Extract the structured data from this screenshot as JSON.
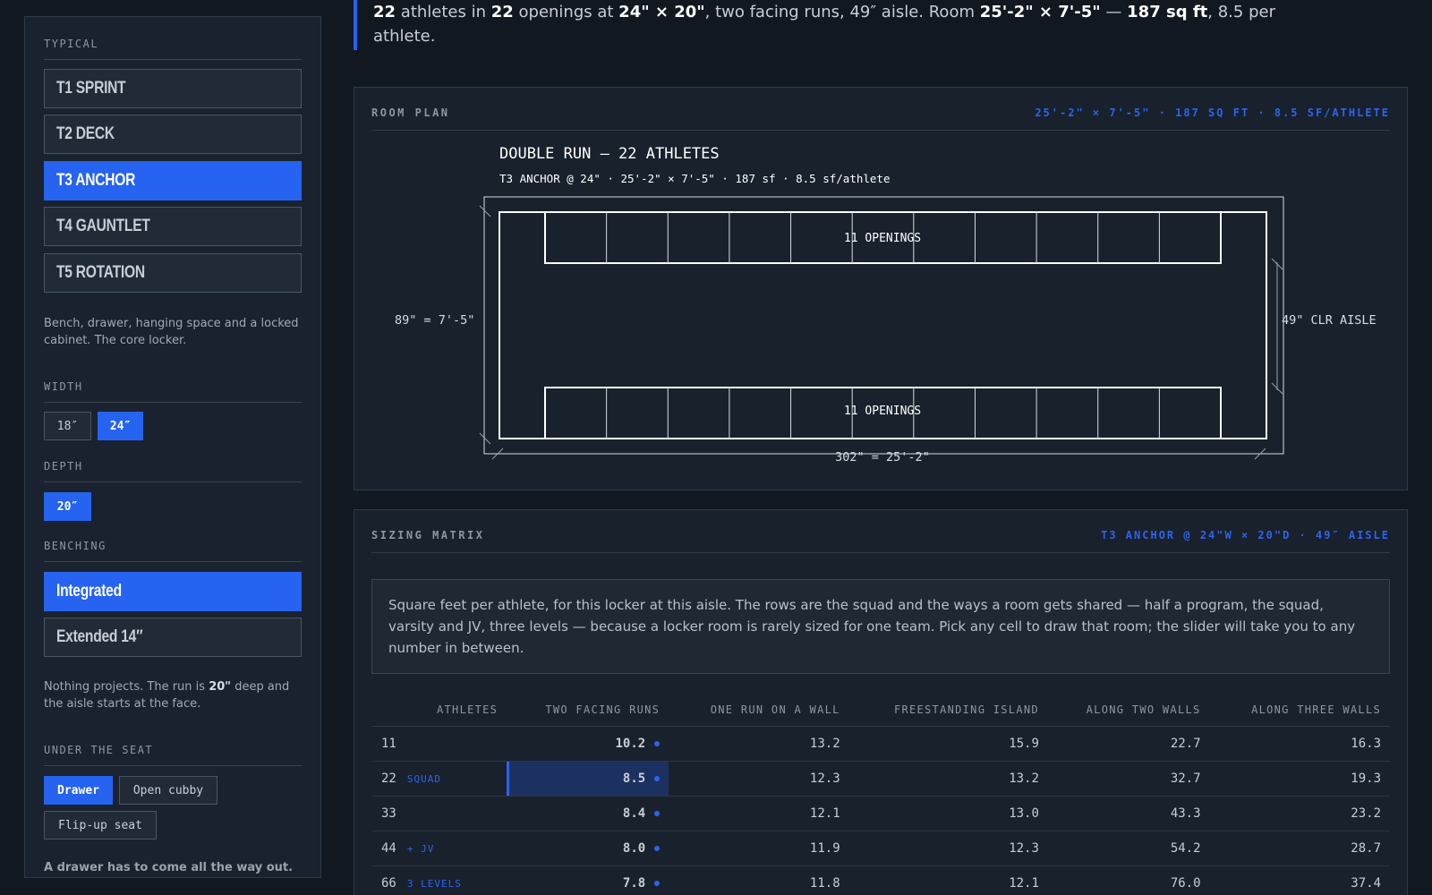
{
  "sidebar": {
    "typical_label": "TYPICAL",
    "types": [
      {
        "label": "T1 SPRINT",
        "active": false
      },
      {
        "label": "T2 DECK",
        "active": false
      },
      {
        "label": "T3 ANCHOR",
        "active": true
      },
      {
        "label": "T4 GAUNTLET",
        "active": false
      },
      {
        "label": "T5 ROTATION",
        "active": false
      }
    ],
    "type_description": "Bench, drawer, hanging space and a locked cabinet. The core locker.",
    "width_label": "WIDTH",
    "widths": [
      {
        "label": "18″",
        "active": false
      },
      {
        "label": "24″",
        "active": true
      }
    ],
    "depth_label": "DEPTH",
    "depths": [
      {
        "label": "20″",
        "active": true
      }
    ],
    "benching_label": "BENCHING",
    "benching": [
      {
        "label": "Integrated",
        "active": true
      },
      {
        "label": "Extended 14″",
        "active": false
      }
    ],
    "benching_note_pre": "Nothing projects. The run is ",
    "benching_note_bold": "20\"",
    "benching_note_post": " deep and the aisle starts at the face.",
    "under_seat_label": "UNDER THE SEAT",
    "under_seat": [
      {
        "label": "Drawer",
        "active": true
      },
      {
        "label": "Open cubby",
        "active": false
      },
      {
        "label": "Flip-up seat",
        "active": false
      }
    ],
    "under_seat_note": "A drawer has to come all the way out."
  },
  "intro": {
    "athletes": "22",
    "t1": " athletes in ",
    "openings": "22",
    "t2": " openings at ",
    "size": "24\" × 20\"",
    "t3": ", two facing runs, 49″ aisle. Room ",
    "room": "25'-2\" × 7'-5\"",
    "t4": " — ",
    "area": "187 sq ft",
    "t5": ", 8.5 per athlete."
  },
  "room_plan": {
    "title": "ROOM PLAN",
    "meta": "25'-2\" × 7'-5\" · 187 SQ FT · 8.5 SF/ATHLETE",
    "drawing_title": "DOUBLE RUN — 22 ATHLETES",
    "drawing_subtitle": "T3 ANCHOR @ 24\" · 25'-2\" × 7'-5\" · 187 sf · 8.5 sf/athlete",
    "top_run_label": "11 OPENINGS",
    "bottom_run_label": "11 OPENINGS",
    "openings_per_run": 11,
    "height_dim": "89\" = 7'-5\"",
    "aisle_dim": "49\" CLR AISLE",
    "length_dim": "302\" = 25'-2\""
  },
  "sizing_matrix": {
    "title": "SIZING MATRIX",
    "meta": "T3 ANCHOR @ 24\"W × 20\"D · 49″ AISLE",
    "note": "Square feet per athlete, for this locker at this aisle. The rows are the squad and the ways a room gets shared — half a program, the squad, varsity and JV, three levels — because a locker room is rarely sized for one team. Pick any cell to draw that room; the slider will take you to any number in between.",
    "columns": [
      "ATHLETES",
      "TWO FACING RUNS",
      "ONE RUN ON A WALL",
      "FREESTANDING ISLAND",
      "ALONG TWO WALLS",
      "ALONG THREE WALLS"
    ],
    "rows": [
      {
        "athletes": "11",
        "tag": "",
        "values": [
          "10.2",
          "13.2",
          "15.9",
          "22.7",
          "16.3"
        ],
        "selected": false
      },
      {
        "athletes": "22",
        "tag": "SQUAD",
        "values": [
          "8.5",
          "12.3",
          "13.2",
          "32.7",
          "19.3"
        ],
        "selected": true
      },
      {
        "athletes": "33",
        "tag": "",
        "values": [
          "8.4",
          "12.1",
          "13.0",
          "43.3",
          "23.2"
        ],
        "selected": false
      },
      {
        "athletes": "44",
        "tag": "+ JV",
        "values": [
          "8.0",
          "11.9",
          "12.3",
          "54.2",
          "28.7"
        ],
        "selected": false
      },
      {
        "athletes": "66",
        "tag": "3 LEVELS",
        "values": [
          "7.8",
          "11.8",
          "12.1",
          "76.0",
          "37.4"
        ],
        "selected": false
      }
    ]
  },
  "colors": {
    "accent": "#2563f0",
    "background": "#111820",
    "panel": "#18212c"
  }
}
